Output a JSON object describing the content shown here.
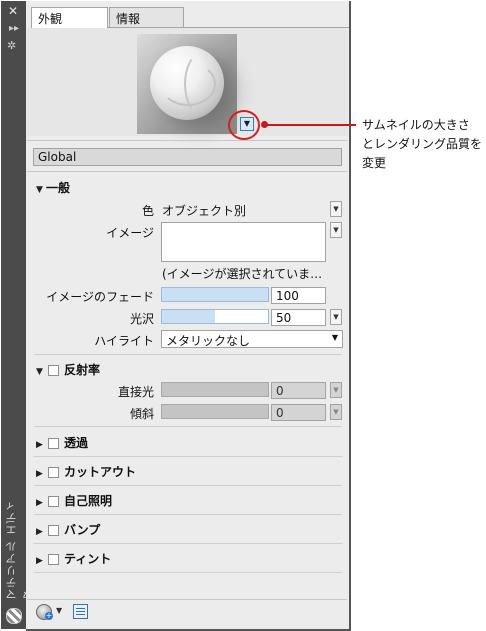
{
  "tabs": [
    "外観",
    "情報"
  ],
  "material_name": "Global",
  "callout": [
    "サムネイルの大きさ",
    "とレンダリング品質を",
    "変更"
  ],
  "sidebar": {
    "title": "マテリアル エディタ"
  },
  "general": {
    "title": "一般",
    "color_label": "色",
    "color_value": "オブジェクト別",
    "image_label": "イメージ",
    "image_note": "(イメージが選択されていま…",
    "fade_label": "イメージのフェード",
    "fade_value": "100",
    "fade_fraction": 1.0,
    "gloss_label": "光沢",
    "gloss_value": "50",
    "gloss_fraction": 0.5,
    "highlight_label": "ハイライト",
    "highlight_value": "メタリックなし"
  },
  "reflectivity": {
    "title": "反射率",
    "direct_label": "直接光",
    "direct_value": "0",
    "oblique_label": "傾斜",
    "oblique_value": "0"
  },
  "sections": {
    "transparency": "透過",
    "cutout": "カットアウト",
    "self_illum": "自己照明",
    "bump": "バンプ",
    "tint": "ティント"
  },
  "icons": {
    "close": "✕",
    "pin": "▸▸",
    "settings": "✲",
    "expanded": "▼",
    "collapsed": "▶",
    "dropdown": "▼"
  }
}
